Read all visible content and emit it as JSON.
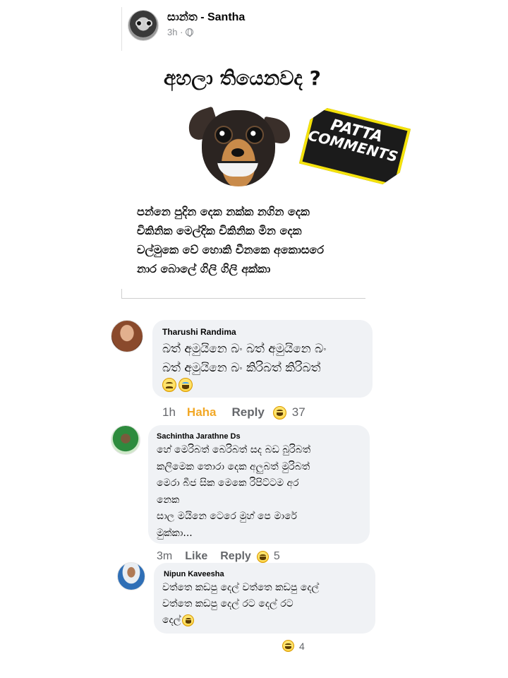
{
  "post": {
    "author": "සාන්ත - Santha",
    "time": "3h ·",
    "privacy_icon": "globe-icon",
    "image": {
      "headline": "අහලා තියෙනවද ?",
      "badge": [
        "PATTA",
        "COMMENTS"
      ],
      "poem": [
        "පන්නෙ පුදින දෙක නක්ක නගින දෙක",
        "චිකිනික මෙල්දික චිකිනික මින දෙක",
        "චල්මුකෙ වේ හොකි චීනකෙ අකොසරෙ",
        "නාර බොලේ ගිලි ගිලි අක්කා"
      ]
    }
  },
  "comments": [
    {
      "name": "Tharushi Randima",
      "lines": [
        "බත් අමුයිනෙ බං බත් අමුයිනෙ බං",
        "බත් අමුයිනෙ බං කිරිබත් කිරිබත්"
      ],
      "time": "1h",
      "reaction_label": "Haha",
      "reply_label": "Reply",
      "reaction_count": "37"
    },
    {
      "name": "Sachintha Jarathne Ds",
      "lines": [
        "හේ මෙරිබත් බෙරිබත් සද බඩ බුරිබත්",
        "කලිමෙක තොරා දෙක අලුබත් මුරිබත්",
        "මෙරා බීජ සික මෙකෙ රිපිට්ටම අර",
        "නෙක",
        "සාල මයිනෙ ටෙරෙ මුහ් පෙ මාරේ",
        "මුක්කා..."
      ],
      "time": "3m",
      "like_label": "Like",
      "reply_label": "Reply",
      "reaction_count": "5"
    },
    {
      "name": "Nipun Kaveesha",
      "lines": [
        "වත්තෙ කඩපු දෙල් වත්තෙ කඩපු දෙල්",
        "වත්තෙ කඩපු දෙල් රට දෙල් රට",
        "දෙල්"
      ],
      "reaction_count": "4"
    }
  ]
}
